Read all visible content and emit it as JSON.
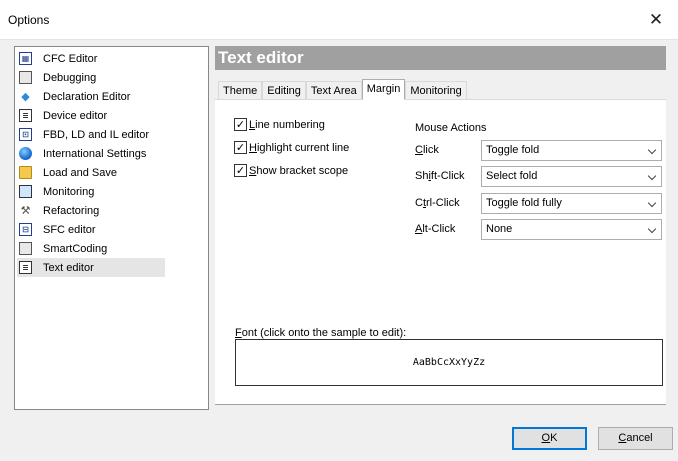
{
  "window": {
    "title": "Options",
    "close_glyph": "✕"
  },
  "sidebar": {
    "items": [
      {
        "label": "CFC Editor",
        "icon": "cfc-editor-icon"
      },
      {
        "label": "Debugging",
        "icon": "debugging-icon"
      },
      {
        "label": "Declaration Editor",
        "icon": "declaration-editor-icon"
      },
      {
        "label": "Device editor",
        "icon": "device-editor-icon"
      },
      {
        "label": "FBD, LD and IL editor",
        "icon": "fbd-ld-il-editor-icon"
      },
      {
        "label": "International Settings",
        "icon": "globe-icon"
      },
      {
        "label": "Load and Save",
        "icon": "folder-icon"
      },
      {
        "label": "Monitoring",
        "icon": "monitoring-icon"
      },
      {
        "label": "Refactoring",
        "icon": "refactoring-icon"
      },
      {
        "label": "SFC editor",
        "icon": "sfc-editor-icon"
      },
      {
        "label": "SmartCoding",
        "icon": "smartcoding-icon"
      },
      {
        "label": "Text editor",
        "icon": "text-editor-icon"
      }
    ],
    "selected": "Text editor"
  },
  "panel": {
    "title": "Text editor"
  },
  "tabs": [
    {
      "label": "Theme"
    },
    {
      "label": "Editing"
    },
    {
      "label": "Text Area"
    },
    {
      "label": "Margin"
    },
    {
      "label": "Monitoring"
    }
  ],
  "active_tab": "Margin",
  "options": {
    "line_numbering": {
      "mnemonic": "L",
      "rest": "ine numbering",
      "checked": true
    },
    "highlight_current_line": {
      "mnemonic": "H",
      "rest": "ighlight current line",
      "checked": true
    },
    "show_bracket_scope": {
      "mnemonic": "S",
      "rest": "how bracket scope",
      "checked": true
    }
  },
  "mouse_actions": {
    "title": "Mouse Actions",
    "rows": [
      {
        "pre": "",
        "mn": "C",
        "post": "lick",
        "value": "Toggle fold"
      },
      {
        "pre": "Sh",
        "mn": "i",
        "post": "ft-Click",
        "value": "Select fold"
      },
      {
        "pre": "C",
        "mn": "t",
        "post": "rl-Click",
        "value": "Toggle fold fully"
      },
      {
        "pre": "",
        "mn": "A",
        "post": "lt-Click",
        "value": "None"
      }
    ]
  },
  "font": {
    "label_mn": "F",
    "label_rest": "ont (click onto the sample to edit):",
    "sample": "AaBbCcXxYyZz"
  },
  "buttons": {
    "ok_mn": "O",
    "ok_rest": "K",
    "cancel_mn": "C",
    "cancel_rest": "ancel"
  },
  "colors": {
    "panel_header_bg": "#a0a0a0",
    "default_button_border": "#0078d7"
  }
}
